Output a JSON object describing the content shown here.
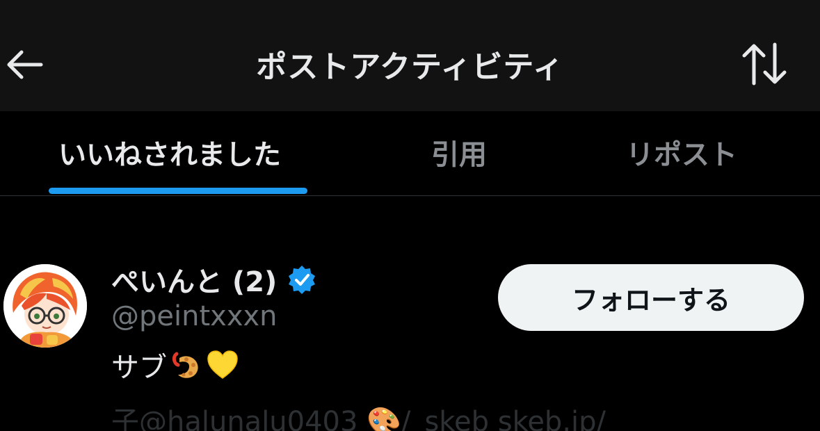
{
  "header": {
    "title": "ポストアクティビティ",
    "back_icon": "arrow-left-icon",
    "sort_icon": "sort-arrows-icon"
  },
  "tabs": [
    {
      "label": "いいねされました",
      "active": true
    },
    {
      "label": "引用",
      "active": false
    },
    {
      "label": "リポスト",
      "active": false
    }
  ],
  "colors": {
    "background": "#000000",
    "header_background": "#121212",
    "accent": "#1d9bf0",
    "text_primary": "#e7e9ea",
    "text_secondary": "#71767b",
    "button_bg": "#eff3f4"
  },
  "user": {
    "display_name": "ぺいんと (2)",
    "verified": true,
    "handle": "@peintxxxn",
    "bio": "サブ",
    "bio_emojis": [
      "shrimp-tempura-icon",
      "yellow-heart-icon"
    ],
    "follow_label": "フォローする"
  },
  "next_row": {
    "partial_text": "子@halunalu0403 🎨/_skeb    skeb.jp/"
  }
}
